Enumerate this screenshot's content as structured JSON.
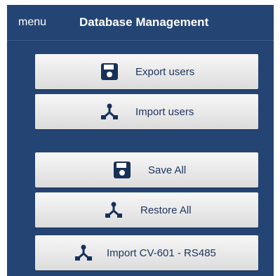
{
  "header": {
    "menu_label": "menu",
    "title": "Database Management"
  },
  "buttons": [
    {
      "label": "Export users",
      "icon": "save-icon"
    },
    {
      "label": "Import users",
      "icon": "import-icon"
    },
    {
      "label": "Save All",
      "icon": "save-icon"
    },
    {
      "label": "Restore All",
      "icon": "import-icon"
    },
    {
      "label": "Import CV-601 - RS485",
      "icon": "import-icon"
    }
  ],
  "colors": {
    "background": "#244574",
    "button_text": "#1f3560",
    "icon": "#17305a"
  }
}
